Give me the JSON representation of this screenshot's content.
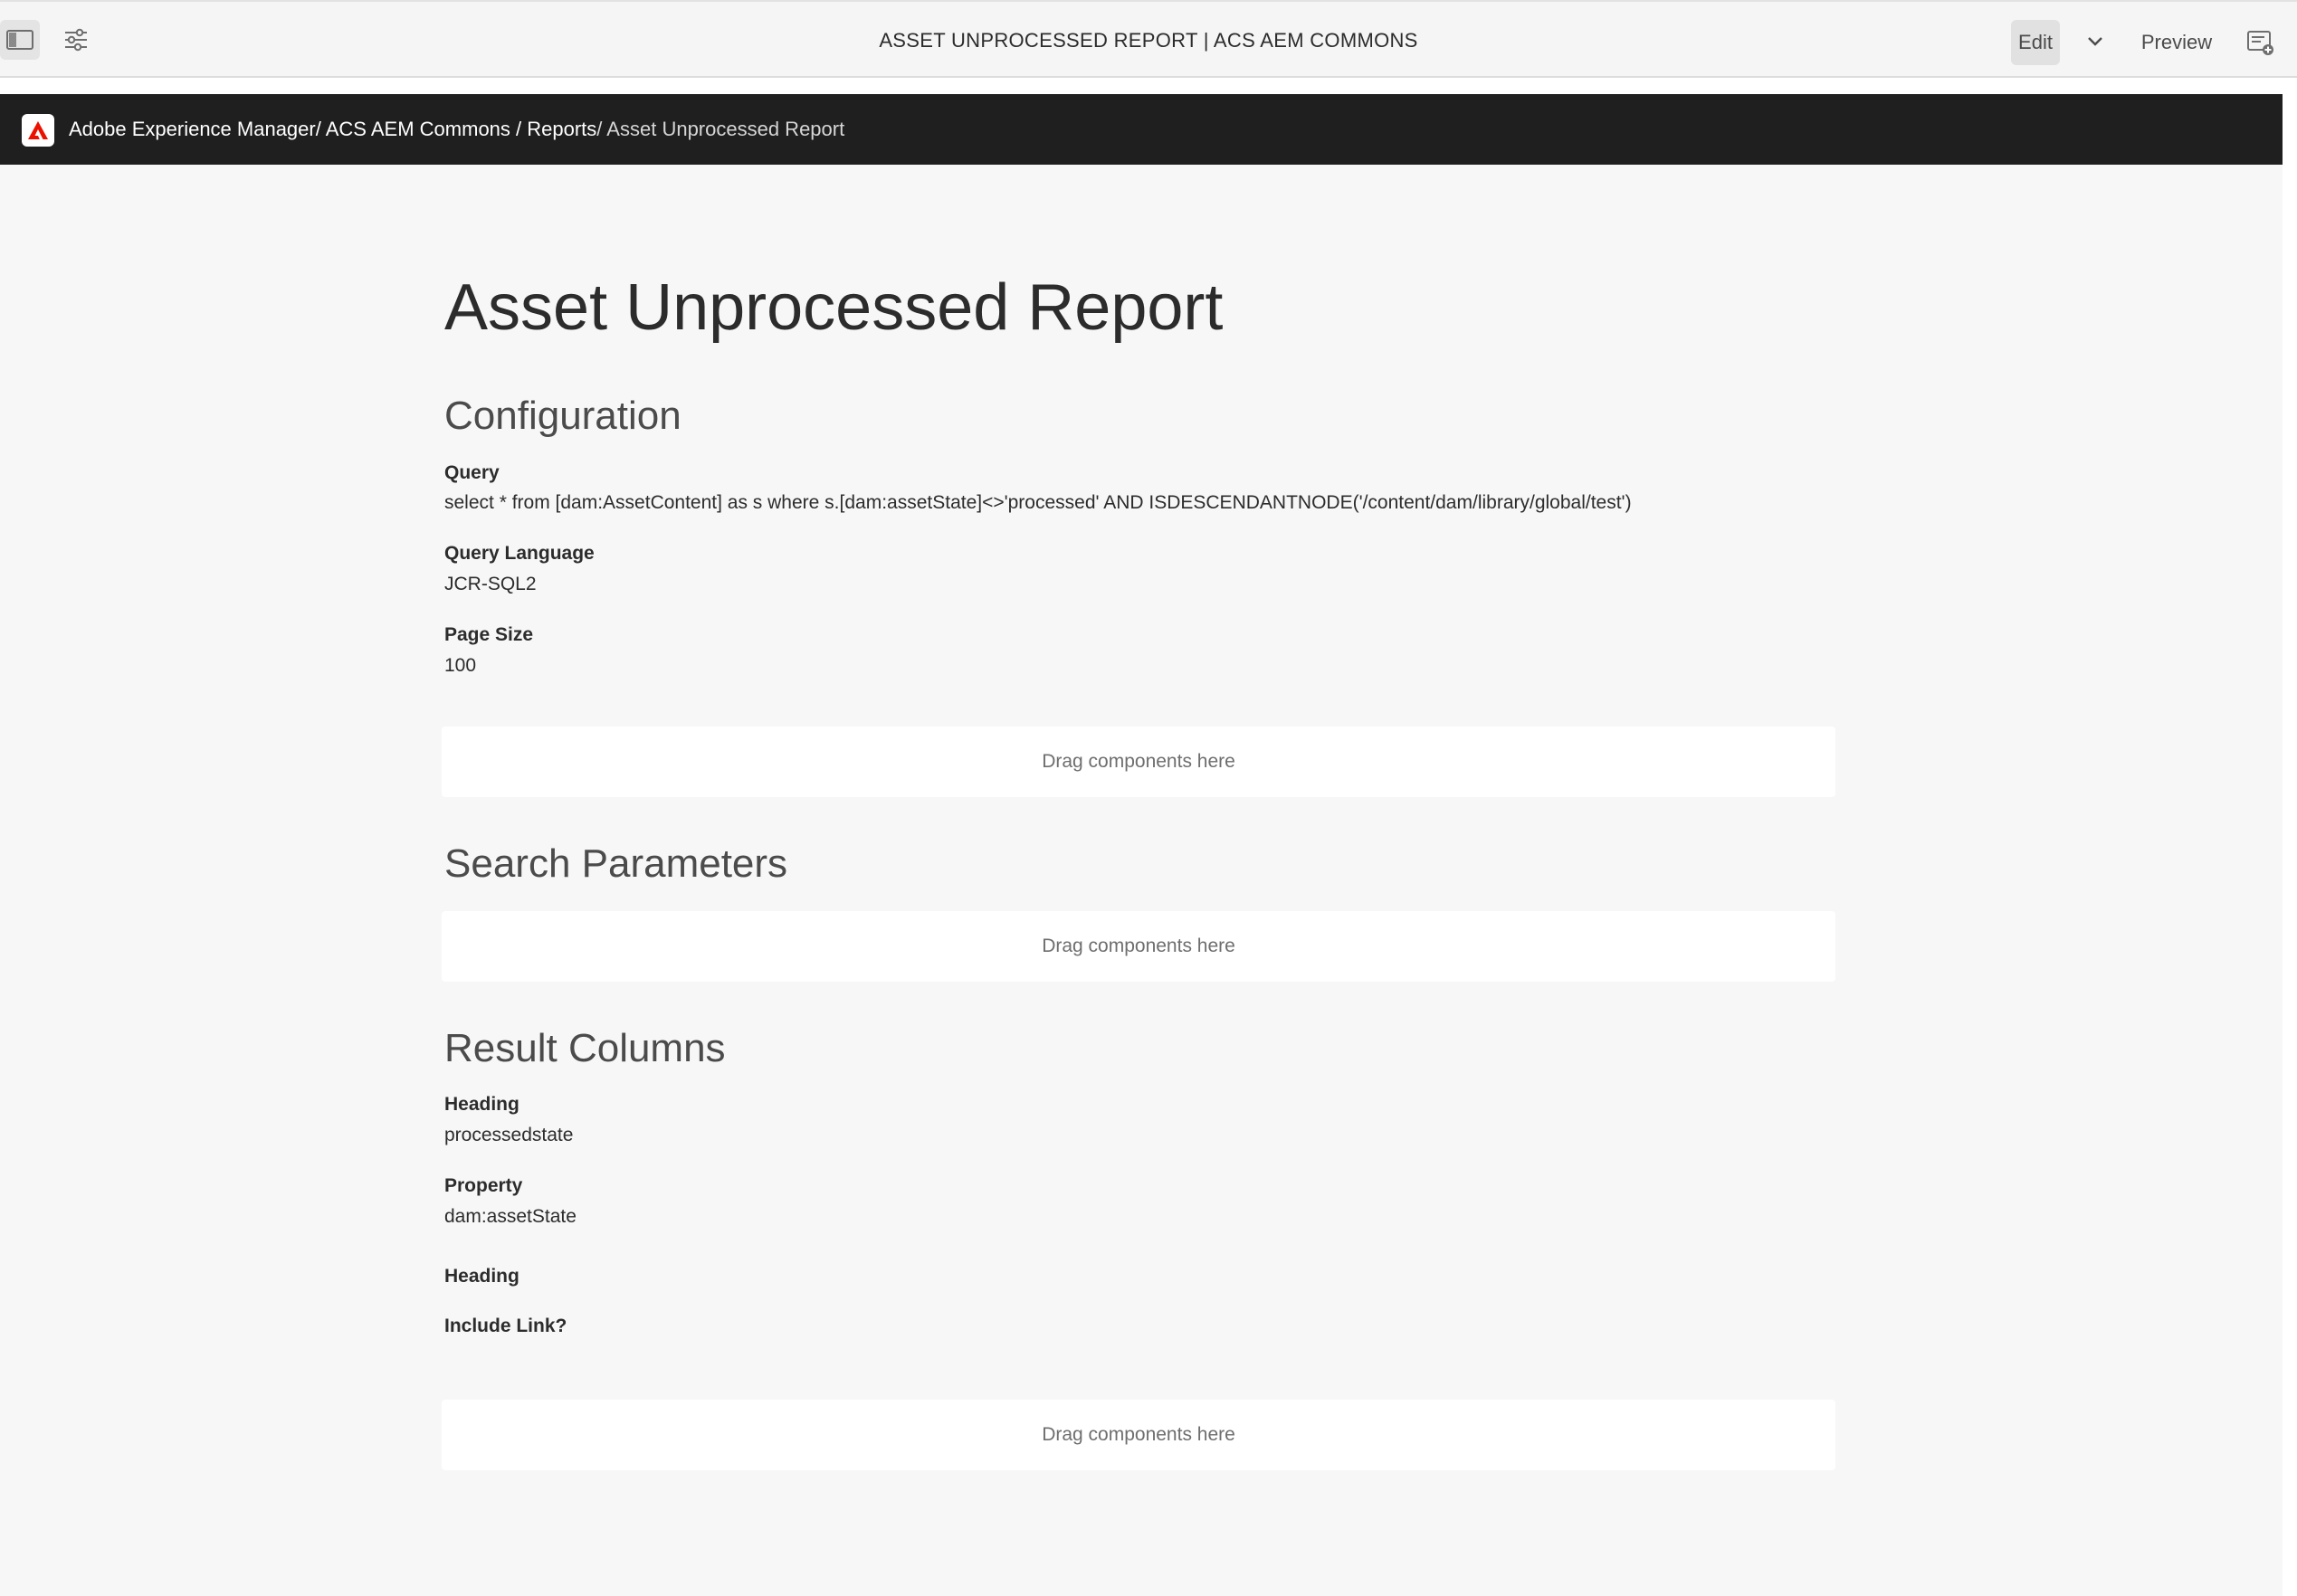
{
  "editor": {
    "title": "ASSET UNPROCESSED REPORT | ACS AEM COMMONS",
    "edit_label": "Edit",
    "preview_label": "Preview"
  },
  "header": {
    "breadcrumb": [
      {
        "label": "Adobe Experience Manager"
      },
      {
        "label": "/ ACS AEM Commons"
      },
      {
        "label": " / Reports"
      },
      {
        "label": "/ Asset Unprocessed Report"
      }
    ]
  },
  "report": {
    "title": "Asset Unprocessed Report",
    "configuration": {
      "title": "Configuration",
      "fields": [
        {
          "label": "Query",
          "value": "select * from [dam:AssetContent] as s where s.[dam:assetState]<>'processed' AND ISDESCENDANTNODE('/content/dam/library/global/test')"
        },
        {
          "label": "Query Language",
          "value": "JCR-SQL2"
        },
        {
          "label": "Page Size",
          "value": "100"
        }
      ]
    },
    "search_parameters": {
      "title": "Search Parameters"
    },
    "result_columns": {
      "title": "Result Columns",
      "fields": [
        {
          "label": "Heading",
          "value": "processedstate"
        },
        {
          "label": "Property",
          "value": "dam:assetState"
        },
        {
          "label": "Heading"
        },
        {
          "label": "Include Link?"
        }
      ]
    },
    "dropzone_label": "Drag components here"
  },
  "colors": {
    "editor_bg": "#f5f5f5",
    "header_bg": "#1f1f1f",
    "page_bg": "#f7f7f7",
    "adobe_red": "#eb1000"
  },
  "icons": {
    "side_panel": "side-panel-icon",
    "page_properties": "sliders-icon",
    "chevron": "chevron-down-icon",
    "annotate": "annotation-icon",
    "logo": "adobe-logo-icon"
  }
}
